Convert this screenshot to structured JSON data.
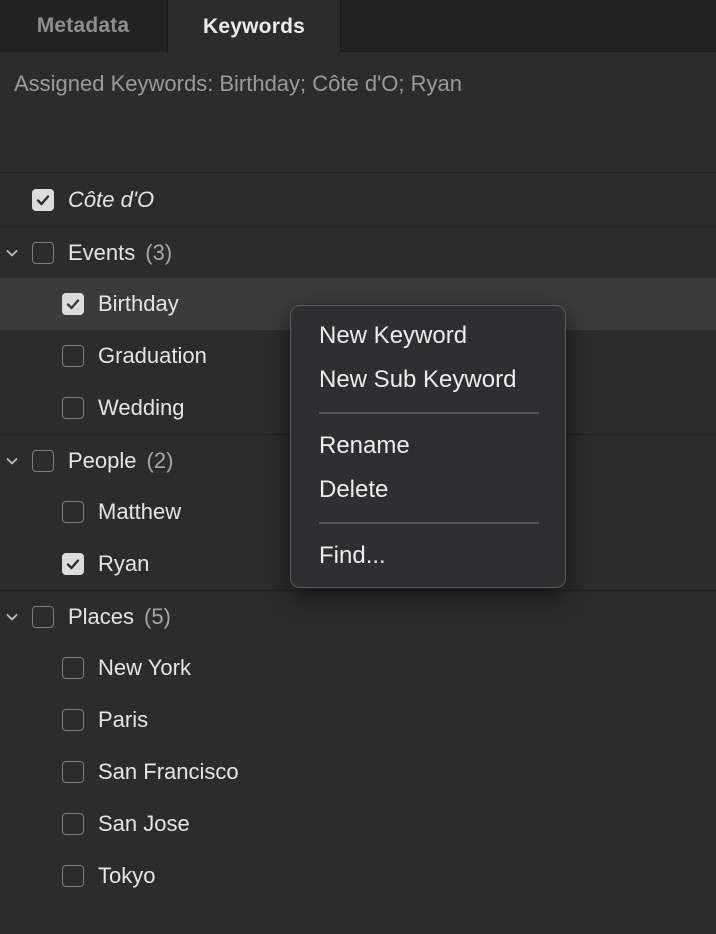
{
  "tabs": [
    {
      "label": "Metadata",
      "active": false
    },
    {
      "label": "Keywords",
      "active": true
    }
  ],
  "assigned": {
    "prefix": "Assigned Keywords:",
    "value": "Birthday; Côte d'O; Ryan"
  },
  "tree": {
    "standalone": {
      "label": "Côte d'O",
      "checked": true
    },
    "groups": [
      {
        "label": "Events",
        "count": "(3)",
        "expanded": true,
        "checked": false,
        "items": [
          {
            "label": "Birthday",
            "checked": true,
            "selected": true
          },
          {
            "label": "Graduation",
            "checked": false
          },
          {
            "label": "Wedding",
            "checked": false
          }
        ]
      },
      {
        "label": "People",
        "count": "(2)",
        "expanded": true,
        "checked": false,
        "items": [
          {
            "label": "Matthew",
            "checked": false
          },
          {
            "label": "Ryan",
            "checked": true
          }
        ]
      },
      {
        "label": "Places",
        "count": "(5)",
        "expanded": true,
        "checked": false,
        "items": [
          {
            "label": "New York",
            "checked": false
          },
          {
            "label": "Paris",
            "checked": false
          },
          {
            "label": "San Francisco",
            "checked": false
          },
          {
            "label": "San Jose",
            "checked": false
          },
          {
            "label": "Tokyo",
            "checked": false
          }
        ]
      }
    ]
  },
  "context_menu": {
    "new_keyword": "New Keyword",
    "new_sub_keyword": "New Sub Keyword",
    "rename": "Rename",
    "delete": "Delete",
    "find": "Find..."
  },
  "colors": {
    "panel_bg": "#2c2c2c",
    "tab_bar_bg": "#232323",
    "selected_row_bg": "#3b3b3b",
    "menu_bg": "#2f2e30"
  },
  "icons": {
    "expand": "chevron-down-icon",
    "checked": "checkmark-icon"
  }
}
